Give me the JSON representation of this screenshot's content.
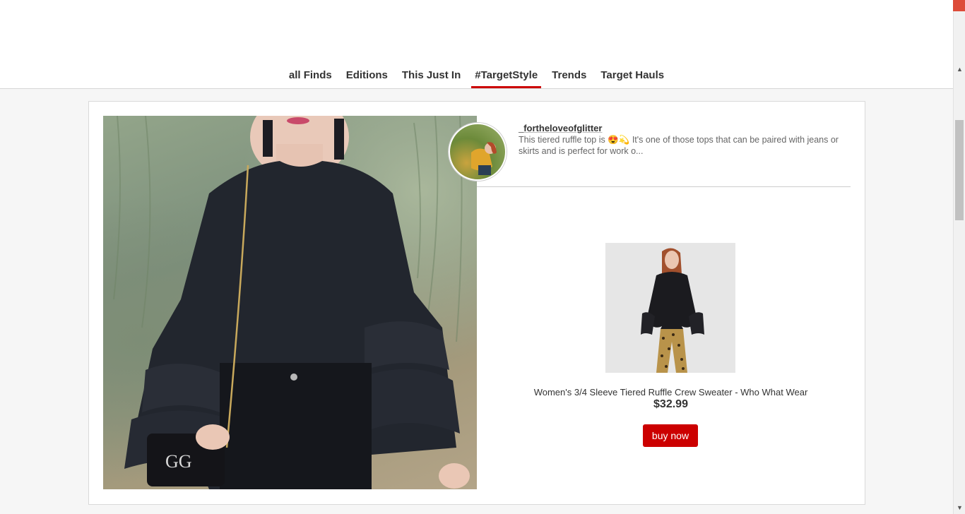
{
  "nav": {
    "items": [
      {
        "label": "all Finds",
        "active": false
      },
      {
        "label": "Editions",
        "active": false
      },
      {
        "label": "This Just In",
        "active": false
      },
      {
        "label": "#TargetStyle",
        "active": true
      },
      {
        "label": "Trends",
        "active": false
      },
      {
        "label": "Target Hauls",
        "active": false
      }
    ]
  },
  "post": {
    "username": "_fortheloveofglitter",
    "caption": "This tiered ruffle top is 😍💫 It's one of those tops that can be paired with jeans or skirts and is perfect for work o..."
  },
  "product": {
    "name": "Women's 3/4 Sleeve Tiered Ruffle Crew Sweater - Who What Wear",
    "price": "$32.99",
    "buy_label": "buy now"
  },
  "scrollbar": {
    "up_arrow": "▲",
    "down_arrow": "▼"
  },
  "colors": {
    "accent": "#cc0000",
    "background": "#f6f6f6"
  }
}
